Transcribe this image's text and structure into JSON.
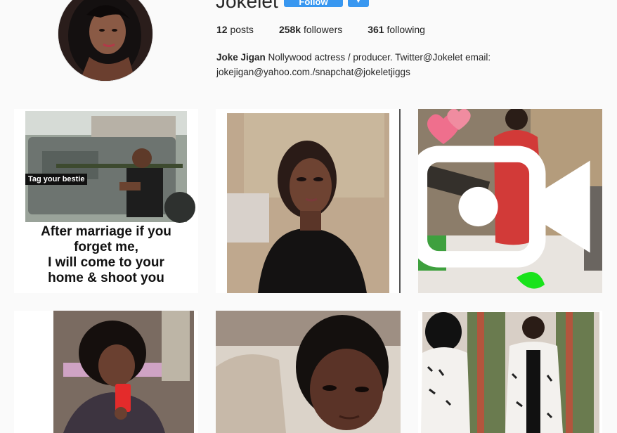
{
  "profile": {
    "username": "Jokelet",
    "follow_label": "Follow",
    "dropdown_icon": "chevron-down-icon",
    "stats": {
      "posts_count": "12",
      "posts_label": "posts",
      "followers_count": "258k",
      "followers_label": "followers",
      "following_count": "361",
      "following_label": "following"
    },
    "bio": {
      "name": "Joke Jigan",
      "text": " Nollywood actress / producer. Twitter@Jokelet email: jokejigan@yahoo.com./snapchat@jokeletjiggs"
    }
  },
  "posts": [
    {
      "kind": "meme",
      "tag_label": "Tag your bestie",
      "caption_lines": [
        "After marriage if you",
        "forget me,",
        "I will come to your",
        "home & shoot you"
      ]
    },
    {
      "kind": "photo"
    },
    {
      "kind": "video",
      "icon": "video-camera-icon"
    },
    {
      "kind": "photo"
    },
    {
      "kind": "photo"
    },
    {
      "kind": "photo"
    }
  ],
  "colors": {
    "accent": "#3897f0",
    "background": "#fafafa",
    "text": "#262626"
  }
}
